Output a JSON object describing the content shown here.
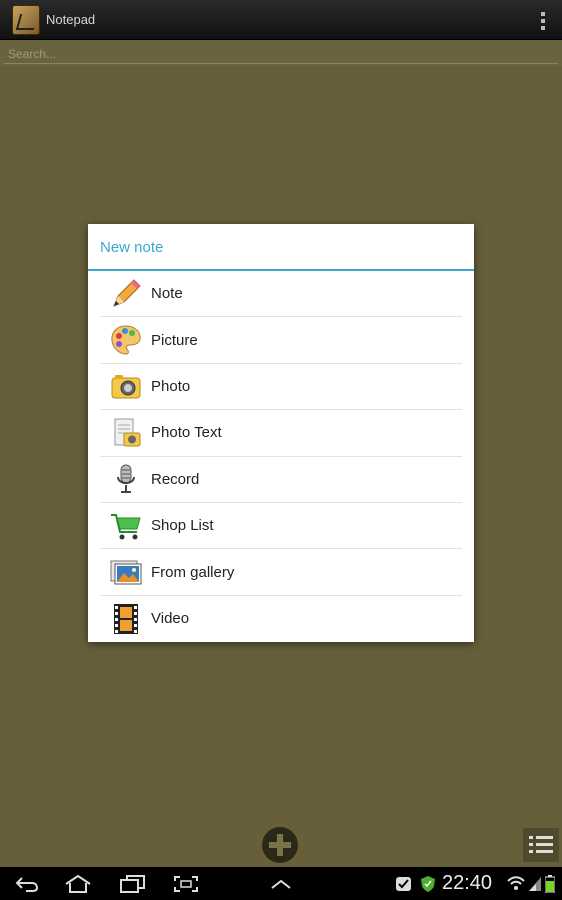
{
  "app": {
    "title": "Notepad",
    "icon": "notepad-app-icon"
  },
  "search": {
    "placeholder": "Search..."
  },
  "dialog": {
    "title": "New note",
    "items": [
      {
        "label": "Note",
        "icon": "pencil-icon"
      },
      {
        "label": "Picture",
        "icon": "palette-icon"
      },
      {
        "label": "Photo",
        "icon": "camera-icon"
      },
      {
        "label": "Photo Text",
        "icon": "document-camera-icon"
      },
      {
        "label": "Record",
        "icon": "microphone-icon"
      },
      {
        "label": "Shop List",
        "icon": "shopping-cart-icon"
      },
      {
        "label": "From gallery",
        "icon": "gallery-icon"
      },
      {
        "label": "Video",
        "icon": "film-icon"
      }
    ]
  },
  "status_bar": {
    "time": "22:40"
  },
  "colors": {
    "background": "#665f3a",
    "accent": "#3aa8cf",
    "action_bar": "#1a1a1a"
  }
}
